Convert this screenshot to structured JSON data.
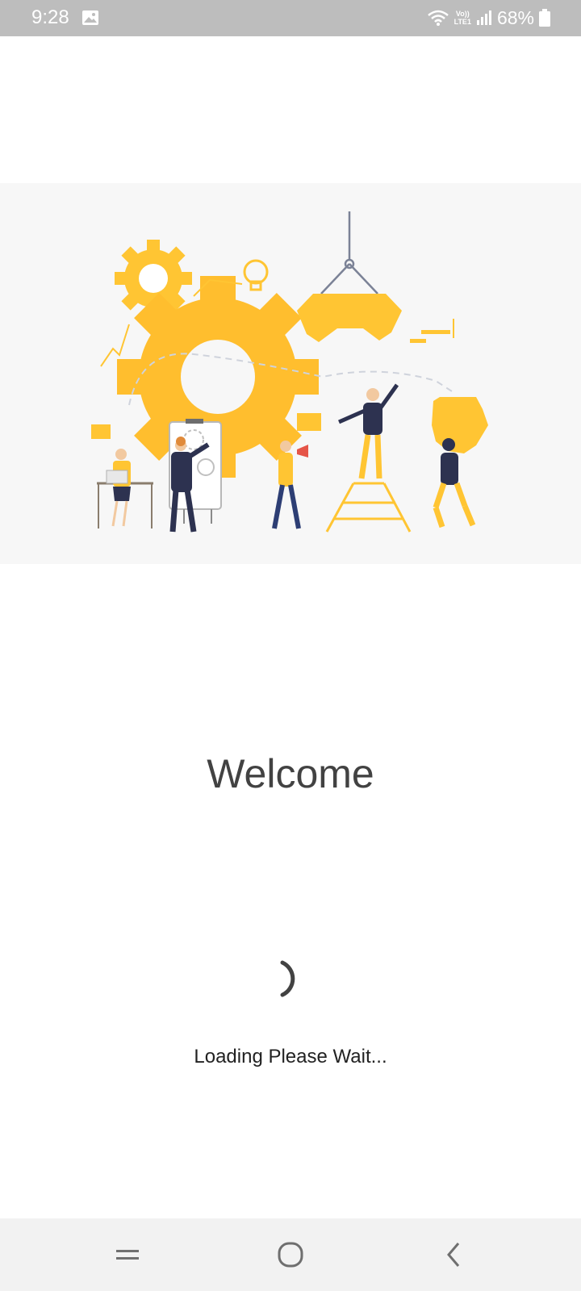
{
  "status_bar": {
    "time": "9:28",
    "lte_label_top": "Vo))",
    "lte_label_bottom": "LTE1",
    "battery_percent": "68%",
    "icons": [
      "gallery-icon",
      "wifi-icon",
      "lte-icon",
      "signal-icon",
      "battery-icon"
    ]
  },
  "hero": {
    "illustration": "team-gears-illustration",
    "accent_color": "#ffc533",
    "dark_color": "#2d3250"
  },
  "main": {
    "welcome": "Welcome",
    "loading": "Loading Please Wait..."
  },
  "nav_bar": {
    "icons": [
      "recent-apps-icon",
      "home-icon",
      "back-icon"
    ]
  }
}
